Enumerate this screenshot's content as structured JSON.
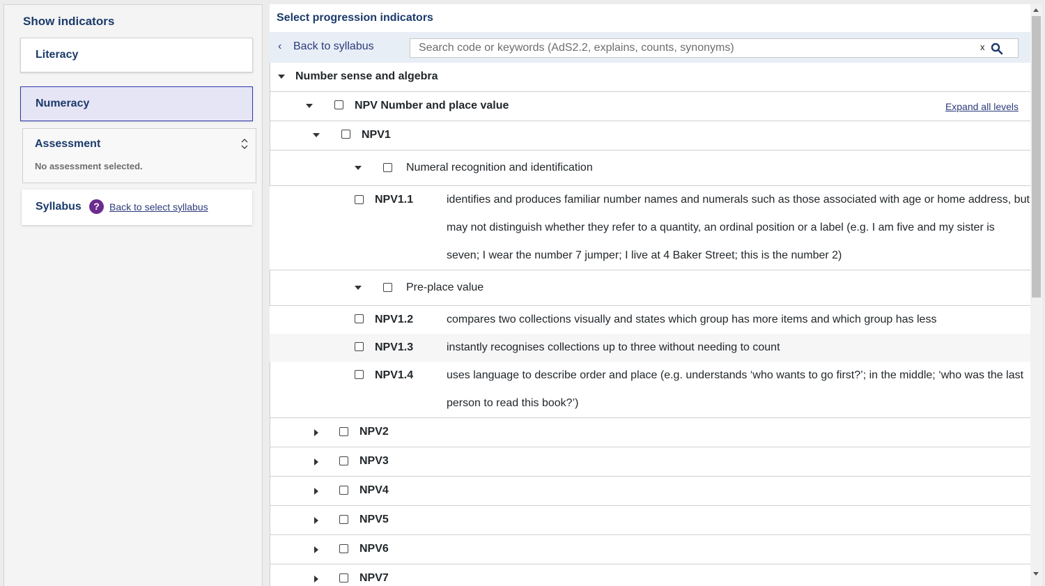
{
  "sidebar": {
    "heading": "Show indicators",
    "literacy_label": "Literacy",
    "numeracy_label": "Numeracy",
    "assessment": {
      "title": "Assessment",
      "status": "No assessment selected."
    },
    "syllabus": {
      "title": "Syllabus",
      "help": "?",
      "link": "Back to select syllabus"
    }
  },
  "main": {
    "title": "Select progression indicators",
    "back_label": "Back to syllabus",
    "search": {
      "placeholder": "Search code or keywords (AdS2.2, explains, counts, synonyms)",
      "clear": "x"
    },
    "expand_all": "Expand all levels",
    "tree": {
      "aspect": "Number sense and algebra",
      "element": "NPV Number and place value",
      "level": "NPV1",
      "groups": [
        {
          "name": "Numeral recognition and identification",
          "indicators": [
            {
              "code": "NPV1.1",
              "text": "identifies and produces familiar number names and numerals such as those associated with age or home address, but may not distinguish whether they refer to a quantity, an ordinal position or a label (e.g. I am five and my sister is seven; I wear the number 7 jumper; I live at 4 Baker Street; this is the number 2)"
            }
          ]
        },
        {
          "name": "Pre-place value",
          "indicators": [
            {
              "code": "NPV1.2",
              "text": "compares two collections visually and states which group has more items and which group has less"
            },
            {
              "code": "NPV1.3",
              "text": "instantly recognises collections up to three without needing to count"
            },
            {
              "code": "NPV1.4",
              "text": "uses language to describe order and place (e.g. understands ‘who wants to go first?’; in the middle; ‘who was the last person to read this book?’)"
            }
          ]
        }
      ],
      "collapsed_levels": [
        "NPV2",
        "NPV3",
        "NPV4",
        "NPV5",
        "NPV6",
        "NPV7"
      ]
    }
  }
}
